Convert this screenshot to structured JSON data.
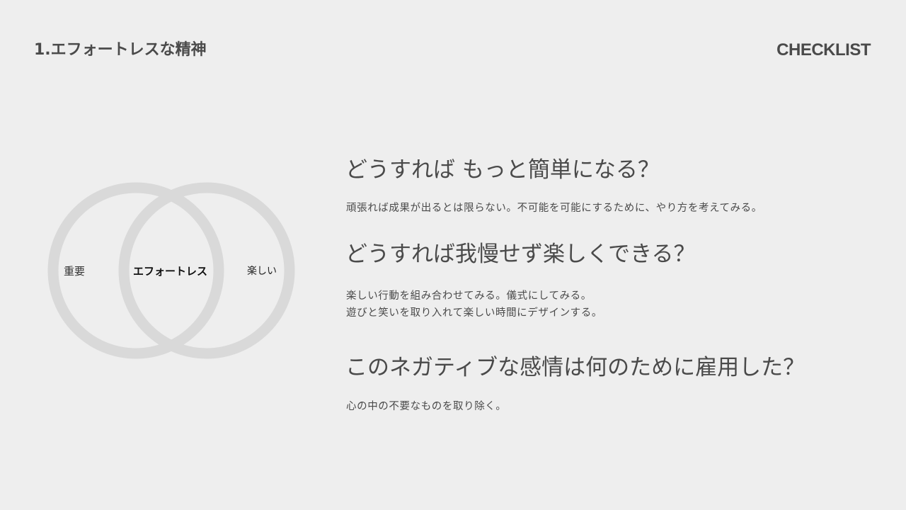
{
  "header": {
    "title": "1.エフォートレスな精神",
    "tag": "CHECKLIST"
  },
  "venn": {
    "left_label": "重要",
    "center_label": "エフォートレス",
    "right_label": "楽しい",
    "ring_color": "#d9d9d9"
  },
  "items": [
    {
      "question": "どうすれば もっと簡単になる？",
      "answer_lines": [
        "頑張れば成果が出るとは限らない。不可能を可能にするために、やり方を考えてみる。"
      ]
    },
    {
      "question": "どうすれば我慢せず楽しくできる？",
      "answer_lines": [
        "楽しい行動を組み合わせてみる。儀式にしてみる。",
        "遊びと笑いを取り入れて楽しい時間にデザインする。"
      ]
    },
    {
      "question": "このネガティブな感情は何のために雇用した？",
      "answer_lines": [
        "心の中の不要なものを取り除く。"
      ]
    }
  ]
}
